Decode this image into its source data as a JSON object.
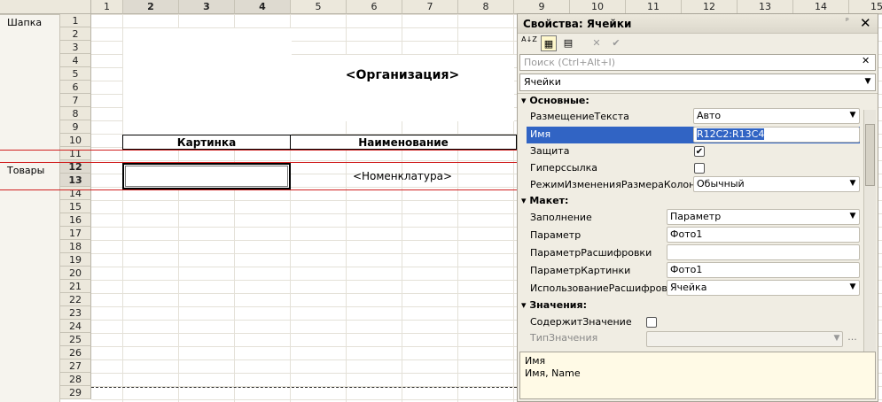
{
  "sheet": {
    "col_headers": [
      "1",
      "2",
      "3",
      "4",
      "5",
      "6",
      "7",
      "8",
      "9",
      "10",
      "11",
      "12",
      "13",
      "14",
      "15"
    ],
    "row_headers": [
      "1",
      "2",
      "3",
      "4",
      "5",
      "6",
      "7",
      "8",
      "9",
      "10",
      "11",
      "12",
      "13",
      "14",
      "15",
      "16",
      "17",
      "18",
      "19",
      "20",
      "21",
      "22",
      "23",
      "24",
      "25",
      "26",
      "27",
      "28",
      "29"
    ],
    "groups": {
      "header": "Шапка",
      "goods": "Товары"
    },
    "organization": "<Организация>",
    "picture_header": "Картинка",
    "name_header": "Наименование",
    "nomenclature": "<Номенклатура>"
  },
  "panel": {
    "title": "Свойства: Ячейки",
    "pin": "ᵖ",
    "close": "✕",
    "toolbar": {
      "sort": "A↓Z",
      "categories": "▦",
      "filter": "▤",
      "clear": "✕",
      "apply": "✔"
    },
    "search_placeholder": "Поиск (Ctrl+Alt+I)",
    "search_clear": "✕",
    "object_type": "Ячейки",
    "sections": {
      "main": "Основные:",
      "layout": "Макет:",
      "values": "Значения:"
    },
    "props": {
      "text_placement": {
        "label": "РазмещениеТекста",
        "value": "Авто"
      },
      "name": {
        "label": "Имя",
        "value": "R12C2:R13C4"
      },
      "protection": {
        "label": "Защита",
        "mark": "✔"
      },
      "hyperlink": {
        "label": "Гиперссылка"
      },
      "resize_mode": {
        "label": "РежимИзмененияРазмераКолонки",
        "value": "Обычный"
      },
      "fill": {
        "label": "Заполнение",
        "value": "Параметр"
      },
      "parameter": {
        "label": "Параметр",
        "value": "Фото1"
      },
      "decode_param": {
        "label": "ПараметрРасшифровки",
        "value": ""
      },
      "picture_param": {
        "label": "ПараметрКартинки",
        "value": "Фото1"
      },
      "use_decode": {
        "label": "ИспользованиеРасшифровки",
        "value": "Ячейка"
      },
      "contains_value": {
        "label": "СодержитЗначение"
      },
      "value_type": {
        "label": "ТипЗначения",
        "value": "",
        "more": "..."
      }
    },
    "description": {
      "title": "Имя",
      "text": "Имя, Name"
    }
  },
  "colors": {
    "selection": "#3164c4",
    "red_lines": "#d02020",
    "header_bg": "#ece8dc"
  }
}
